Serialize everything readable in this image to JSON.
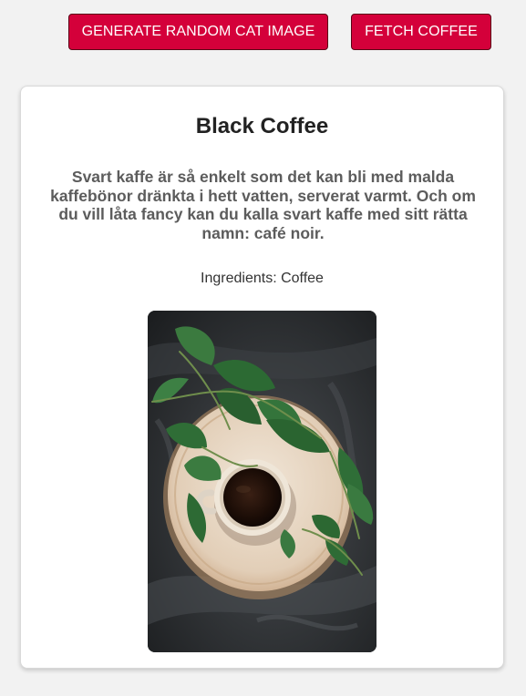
{
  "toolbar": {
    "cat_button_label": "GENERATE RANDOM CAT IMAGE",
    "coffee_button_label": "FETCH COFFEE"
  },
  "coffee": {
    "title": "Black Coffee",
    "description": "Svart kaffe är så enkelt som det kan bli med malda kaffebönor dränkta i hett vatten, serverat varmt. Och om du vill låta fancy kan du kalla svart kaffe med sitt rätta namn: café noir.",
    "ingredients_label": "Ingredients:",
    "ingredients_value": "Coffee"
  },
  "colors": {
    "accent": "#d4003a",
    "background": "#f2f2f2",
    "card": "#ffffff"
  }
}
